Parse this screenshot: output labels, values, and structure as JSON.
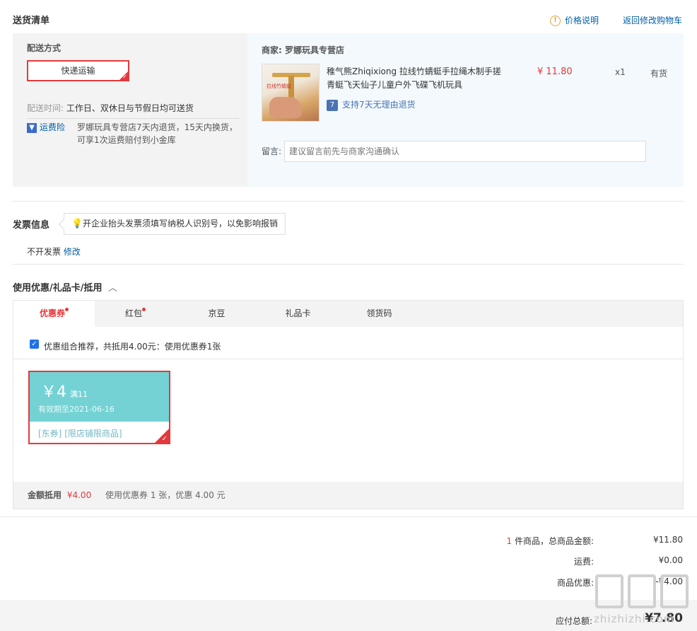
{
  "shipping": {
    "title": "送货清单",
    "price_note": "价格说明",
    "price_note_icon": "!",
    "back_cart": "返回修改购物车",
    "method_label": "配送方式",
    "method_value": "快递运输",
    "time_label": "配送时间:",
    "time_value": "工作日、双休日与节假日均可送货",
    "insurance_label": "运费险",
    "insurance_desc_line1": "罗娜玩具专营店7天内退货，15天内换货，",
    "insurance_desc_line2": "可享1次运费赔付到小金库"
  },
  "shop": {
    "label": "商家:",
    "name": "罗娜玩具专营店",
    "product": {
      "title_line1": "稚气熊Zhiqixiong 拉线竹蜻蜓手拉绳木制手搓",
      "title_line2": "青蜓飞天仙子儿童户外飞碟飞机玩具",
      "price": "¥ 11.80",
      "qty": "x1",
      "stock": "有货",
      "return_policy": "支持7天无理由退货",
      "return_icon": "7",
      "image_text": "拉线竹蜻蜓"
    },
    "message_label": "留言:",
    "message_placeholder": "建议留言前先与商家沟通确认"
  },
  "invoice": {
    "title": "发票信息",
    "tip": "开企业抬头发票须填写纳税人识别号，以免影响报销",
    "status": "不开发票",
    "edit": "修改"
  },
  "discount": {
    "title": "使用优惠/礼品卡/抵用",
    "tabs": [
      {
        "label": "优惠券"
      },
      {
        "label": "红包"
      },
      {
        "label": "京豆"
      },
      {
        "label": "礼品卡"
      },
      {
        "label": "领货码"
      }
    ],
    "recommend_text": "优惠组合推荐，共抵用4.00元：使用优惠券1张",
    "coupon": {
      "amount": "￥4",
      "condition": "满11",
      "expiry": "有效期至2021-06-16",
      "tag1": "[东券]",
      "tag2": "[限店铺限商品]"
    },
    "summary_label": "金额抵用",
    "summary_amount": "¥4.00",
    "summary_desc": "使用优惠券 1 张，优惠 4.00 元"
  },
  "totals": {
    "count": "1",
    "count_suffix": "件商品，总商品金额:",
    "goods_amount": "¥11.80",
    "freight_label": "运费:",
    "freight_amount": "¥0.00",
    "discount_label": "商品优惠:",
    "discount_amount": "-¥4.00",
    "payable_label": "应付总额:",
    "payable_amount": "¥7.80"
  },
  "watermark": {
    "text": "zhizhizhi.com"
  },
  "colors": {
    "accent_red": "#e4393c",
    "link_blue": "#005ea7",
    "coupon_teal": "#74d2d4"
  }
}
